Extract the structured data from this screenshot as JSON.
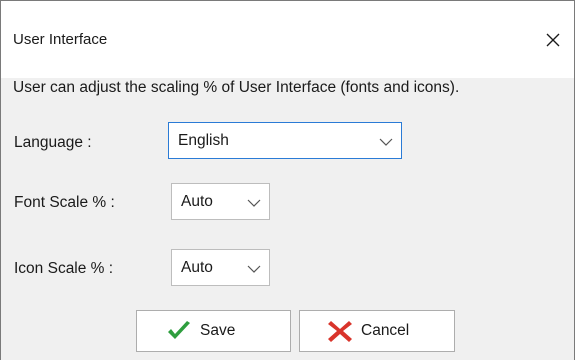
{
  "window": {
    "title": "User Interface"
  },
  "description": "User can adjust the scaling % of User Interface (fonts and icons).",
  "fields": {
    "language": {
      "label": "Language :",
      "value": "English"
    },
    "font_scale": {
      "label": "Font Scale % :",
      "value": "Auto"
    },
    "icon_scale": {
      "label": "Icon Scale % :",
      "value": "Auto"
    }
  },
  "buttons": {
    "save": {
      "label": "Save",
      "icon": "checkmark-icon",
      "icon_color": "#2e9e3e"
    },
    "cancel": {
      "label": "Cancel",
      "icon": "cross-icon",
      "icon_color": "#d9342b"
    }
  },
  "colors": {
    "focus_border": "#2a7bd6",
    "dialog_background": "#f0f0f0"
  }
}
